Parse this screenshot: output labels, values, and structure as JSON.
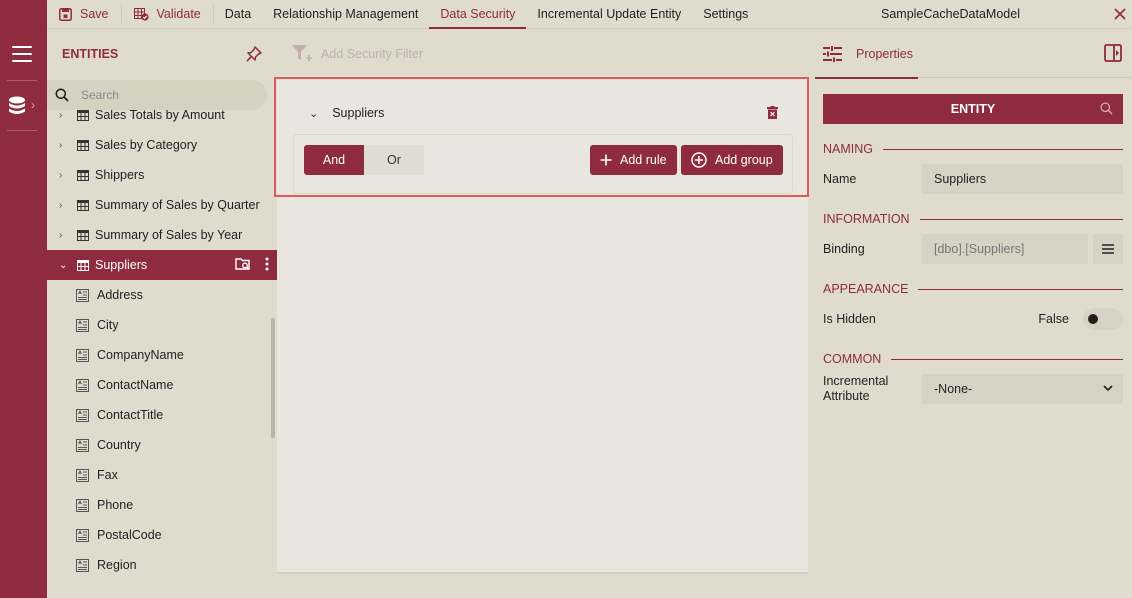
{
  "app": {
    "model_title": "SampleCacheDataModel",
    "colors": {
      "accent": "#8f2b3f",
      "background": "#dfdccd",
      "canvas": "#e8e6df",
      "highlight_border": "#e05a5a"
    }
  },
  "toolbar": {
    "save_label": "Save",
    "validate_label": "Validate",
    "tabs": [
      {
        "label": "Data",
        "active": false
      },
      {
        "label": "Relationship Management",
        "active": false
      },
      {
        "label": "Data Security",
        "active": true
      },
      {
        "label": "Incremental Update Entity",
        "active": false
      },
      {
        "label": "Settings",
        "active": false
      }
    ],
    "close_icon": "close-icon"
  },
  "rail": {
    "icons": [
      "menu-icon",
      "database-icon"
    ]
  },
  "entities": {
    "title": "ENTITIES",
    "search_placeholder": "Search",
    "tables": [
      {
        "label": "Sales Totals by Amount",
        "expanded": false
      },
      {
        "label": "Sales by Category",
        "expanded": false
      },
      {
        "label": "Shippers",
        "expanded": false
      },
      {
        "label": "Summary of Sales by Quarter",
        "expanded": false
      },
      {
        "label": "Summary of Sales by Year",
        "expanded": false
      },
      {
        "label": "Suppliers",
        "expanded": true,
        "selected": true
      }
    ],
    "fields": [
      "Address",
      "City",
      "CompanyName",
      "ContactName",
      "ContactTitle",
      "Country",
      "Fax",
      "Phone",
      "PostalCode",
      "Region"
    ]
  },
  "security": {
    "add_filter_label": "Add Security Filter",
    "group_title": "Suppliers",
    "logic": {
      "options": [
        "And",
        "Or"
      ],
      "selected": "And"
    },
    "add_rule_label": "Add rule",
    "add_group_label": "Add group"
  },
  "properties": {
    "tab_label": "Properties",
    "entity_header": "ENTITY",
    "sections": {
      "naming": "NAMING",
      "information": "INFORMATION",
      "appearance": "APPEARANCE",
      "common": "COMMON"
    },
    "name_label": "Name",
    "name_value": "Suppliers",
    "binding_label": "Binding",
    "binding_value": "[dbo].[Suppliers]",
    "is_hidden_label": "Is Hidden",
    "is_hidden_value": "False",
    "incremental_label": "Incremental Attribute",
    "incremental_value": "-None-"
  }
}
